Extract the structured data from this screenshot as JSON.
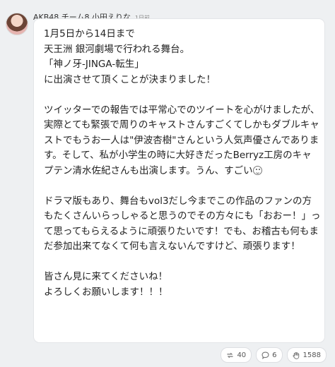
{
  "post": {
    "author": "AKB48 チーム8 小田えりな",
    "time": "1日前",
    "paragraphs": [
      [
        "1月5日から14日まで",
        "天王洲 銀河劇場で行われる舞台。",
        "「神ノ牙-JINGA-転生」",
        "に出演させて頂くことが決まりました！"
      ],
      [
        "ツイッターでの報告では平常心でのツイートを心がけましたが、実際とても緊張で周りのキャストさんすごくてしかもダブルキャストでもうお一人は\"伊波杏樹\"さんという人気声優さんであります。そして、私が小学生の時に大好きだったBerryz工房のキャプテン清水佐紀さんも出演します。うん、すごい"
      ],
      [
        "ドラマ版もあり、舞台もvol3だし今までこの作品のファンの方もたくさんいらっしゃると思うのでその方々にも「おおー！」って思ってもらえるように頑張りたいです！でも、お稽古も何もまだ参加出来てなくて何も言えないんですけど、頑張ります！"
      ],
      [
        "皆さん見に来てくださいね！",
        "よろしくお願いします！！！"
      ]
    ]
  },
  "actions": {
    "repost_count": "40",
    "comment_count": "6",
    "like_count": "1588"
  },
  "icons": [
    "avatar",
    "smile-emoji-icon",
    "repost-icon",
    "comment-icon",
    "like-hand-icon"
  ]
}
